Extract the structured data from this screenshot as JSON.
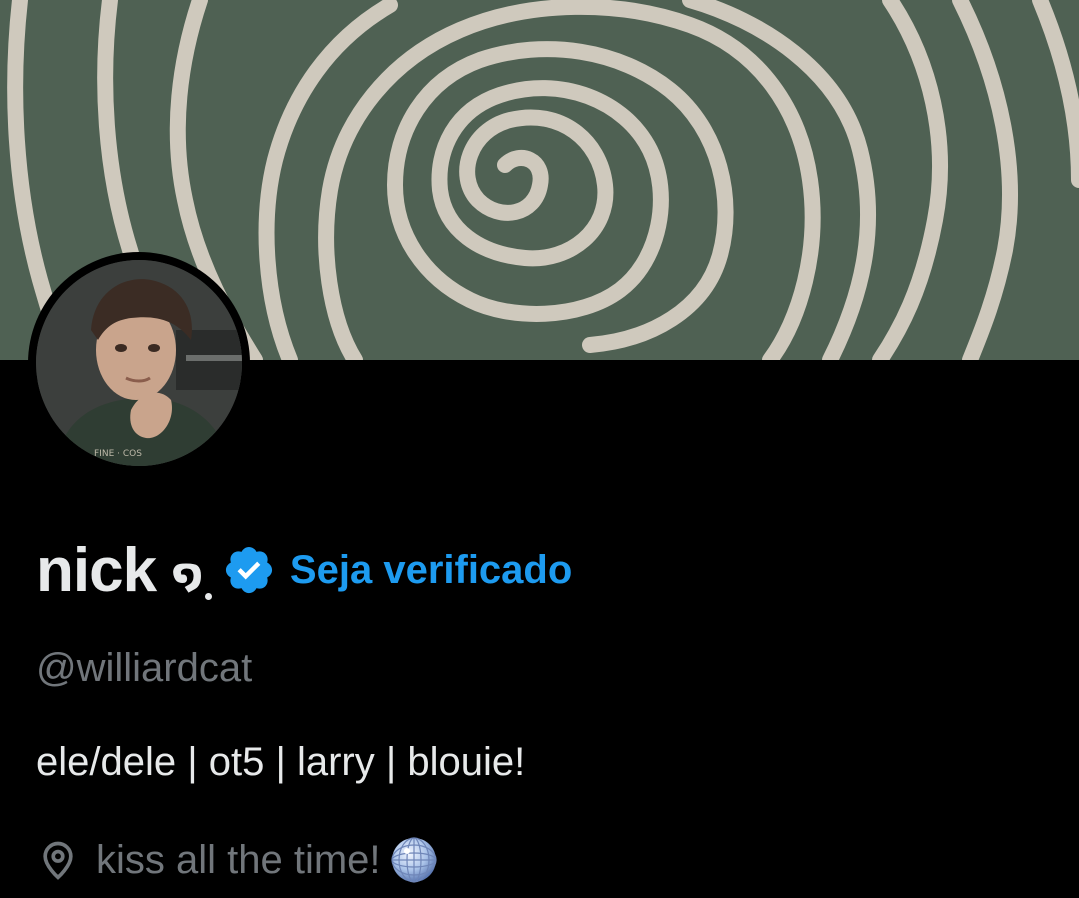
{
  "profile": {
    "display_name": "nick",
    "name_glyph": "໑",
    "get_verified_label": "Seja verificado",
    "handle": "@williardcat",
    "bio": "ele/dele | ot5 | larry | blouie!",
    "location": "kiss all the time!"
  },
  "icons": {
    "verified": "verified-badge-icon",
    "location": "location-pin-icon",
    "location_emoji": "mirror-ball-icon"
  },
  "colors": {
    "background": "#000000",
    "primary_text": "#e7e9ea",
    "secondary_text": "#71767b",
    "accent": "#1d9bf0",
    "banner": "#4d5e52"
  }
}
